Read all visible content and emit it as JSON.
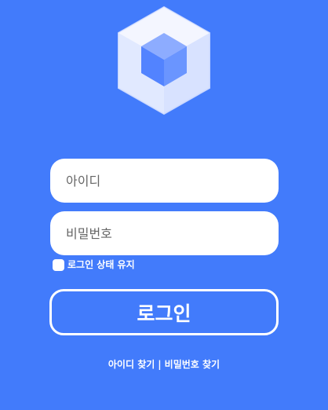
{
  "login_form": {
    "id_placeholder": "아이디",
    "password_placeholder": "비밀번호",
    "remember_label": "로그인 상태 유지",
    "remember_checked": false,
    "login_button_label": "로그인"
  },
  "footer_links": {
    "find_id": "아이디 찾기",
    "separator": "|",
    "find_password": "비밀번호 찾기"
  },
  "colors": {
    "background": "#427bfb",
    "hexagon_outer": "#e9efff",
    "cube_top": "#8dacff",
    "cube_side": "#5a88ff"
  },
  "icons": {
    "logo": "hexagon-cube-logo-icon",
    "checkbox": "checkbox-icon"
  }
}
